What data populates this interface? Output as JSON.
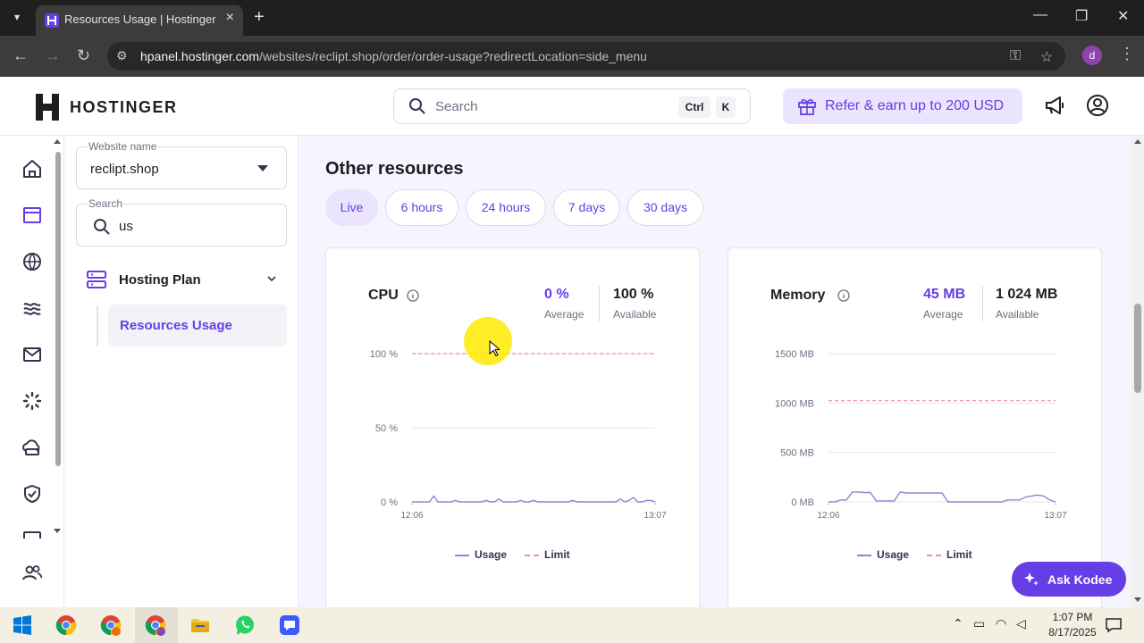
{
  "browser": {
    "tab_title": "Resources Usage | Hostinger",
    "url_domain": "hpanel.hostinger.com",
    "url_path": "/websites/reclipt.shop/order/order-usage?redirectLocation=side_menu",
    "profile_initial": "d"
  },
  "header": {
    "logo_text": "HOSTINGER",
    "search_placeholder": "Search",
    "kbd_ctrl": "Ctrl",
    "kbd_k": "K",
    "refer_label": "Refer & earn up to 200 USD"
  },
  "sidebar": {
    "website_label": "Website name",
    "website_value": "reclipt.shop",
    "search_label": "Search",
    "search_value": "us",
    "section_label": "Hosting Plan",
    "active_item": "Resources Usage"
  },
  "main": {
    "section_title": "Other resources",
    "ranges": [
      "Live",
      "6 hours",
      "24 hours",
      "7 days",
      "30 days"
    ],
    "active_range": "Live",
    "legend_usage": "Usage",
    "legend_limit": "Limit"
  },
  "cpu": {
    "title": "CPU",
    "average_value": "0 %",
    "average_label": "Average",
    "available_value": "100 %",
    "available_label": "Available"
  },
  "memory": {
    "title": "Memory",
    "average_value": "45 MB",
    "average_label": "Average",
    "available_value": "1 024 MB",
    "available_label": "Available"
  },
  "chart_data": [
    {
      "type": "line",
      "title": "CPU",
      "x_tick_labels": [
        "12:06",
        "13:07"
      ],
      "y_tick_labels": [
        "0 %",
        "50 %",
        "100 %"
      ],
      "ylim": [
        0,
        100
      ],
      "series": [
        {
          "name": "Usage",
          "values": [
            0,
            0,
            0,
            0,
            0,
            4,
            0,
            0,
            0,
            0,
            1,
            0,
            0,
            0,
            0,
            0,
            0,
            1,
            0,
            0,
            2,
            0,
            0,
            0,
            0,
            1,
            0,
            0,
            1,
            0,
            0,
            0,
            0,
            0,
            0,
            0,
            0,
            1,
            0,
            0,
            0,
            0,
            0,
            0,
            0,
            0,
            0,
            0,
            2,
            0,
            1,
            3,
            0,
            0,
            1,
            1,
            0
          ]
        },
        {
          "name": "Limit",
          "values": [
            100,
            100
          ]
        }
      ],
      "grid": true,
      "legend": "bottom"
    },
    {
      "type": "line",
      "title": "Memory",
      "x_tick_labels": [
        "12:06",
        "13:07"
      ],
      "y_tick_labels": [
        "0 MB",
        "500 MB",
        "1000 MB",
        "1500 MB"
      ],
      "ylim": [
        0,
        1500
      ],
      "series": [
        {
          "name": "Usage",
          "values": [
            0,
            0,
            20,
            20,
            100,
            100,
            95,
            95,
            10,
            10,
            10,
            10,
            100,
            90,
            90,
            90,
            90,
            90,
            90,
            90,
            0,
            0,
            0,
            0,
            0,
            0,
            0,
            0,
            0,
            0,
            20,
            20,
            20,
            50,
            60,
            70,
            60,
            20,
            0
          ]
        },
        {
          "name": "Limit",
          "values": [
            1024,
            1024
          ]
        }
      ],
      "grid": true,
      "legend": "bottom"
    }
  ],
  "assistant": {
    "label": "Ask Kodee"
  },
  "taskbar": {
    "time": "1:07 PM",
    "date": "8/17/2025"
  },
  "colors": {
    "brand": "#673de6",
    "limit_line": "#f08e99",
    "usage_line": "#8c85d6"
  }
}
